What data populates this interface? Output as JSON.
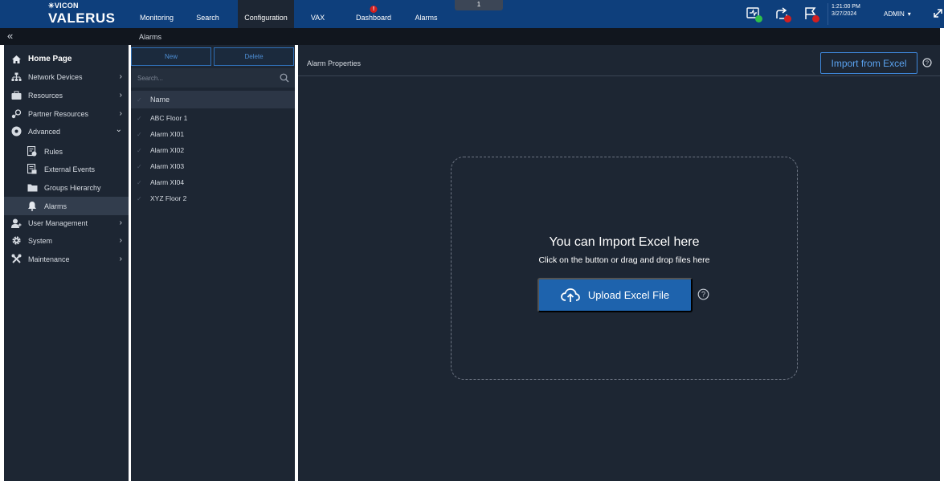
{
  "brand": {
    "vicon": "✳VICON",
    "valerus": "VALERUS"
  },
  "nav_tabs": [
    {
      "label": "Monitoring"
    },
    {
      "label": "Search"
    },
    {
      "label": "Configuration"
    },
    {
      "label": "VAX"
    },
    {
      "label": "Dashboard",
      "badge": "!"
    },
    {
      "label": "Alarms"
    }
  ],
  "center_tab": "1",
  "clock": {
    "time": "1:21:00 PM",
    "date": "3/27/2024"
  },
  "user": {
    "name": "ADMIN",
    "caret": "▾"
  },
  "collapse_glyph": "«",
  "breadcrumb": "Alarms",
  "sidebar": {
    "items": [
      {
        "label": "Home Page"
      },
      {
        "label": "Network Devices",
        "chevron": "›"
      },
      {
        "label": "Resources",
        "chevron": "›"
      },
      {
        "label": "Partner Resources",
        "chevron": "›"
      },
      {
        "label": "Advanced",
        "chevron": "⌄"
      },
      {
        "label": "Rules"
      },
      {
        "label": "External Events"
      },
      {
        "label": "Groups Hierarchy"
      },
      {
        "label": "Alarms"
      },
      {
        "label": "User Management",
        "chevron": "›"
      },
      {
        "label": "System",
        "chevron": "›"
      },
      {
        "label": "Maintenance",
        "chevron": "›"
      }
    ]
  },
  "list_panel": {
    "new_label": "New",
    "delete_label": "Delete",
    "search_placeholder": "Search...",
    "column_header": "Name",
    "rows": [
      "ABC Floor 1",
      "Alarm XI01",
      "Alarm XI02",
      "Alarm XI03",
      "Alarm XI04",
      "XYZ Floor 2"
    ]
  },
  "main": {
    "title": "Alarm Properties",
    "import_label": "Import from Excel",
    "drop_title": "You can Import Excel here",
    "drop_subtitle": "Click on the button or drag and drop files here",
    "upload_label": "Upload Excel File"
  },
  "colors": {
    "topbar": "#0e3f7c",
    "panel": "#1d2633",
    "accent": "#1e63ad",
    "badge_red": "#d21f1f",
    "badge_green": "#2fbf4a"
  }
}
